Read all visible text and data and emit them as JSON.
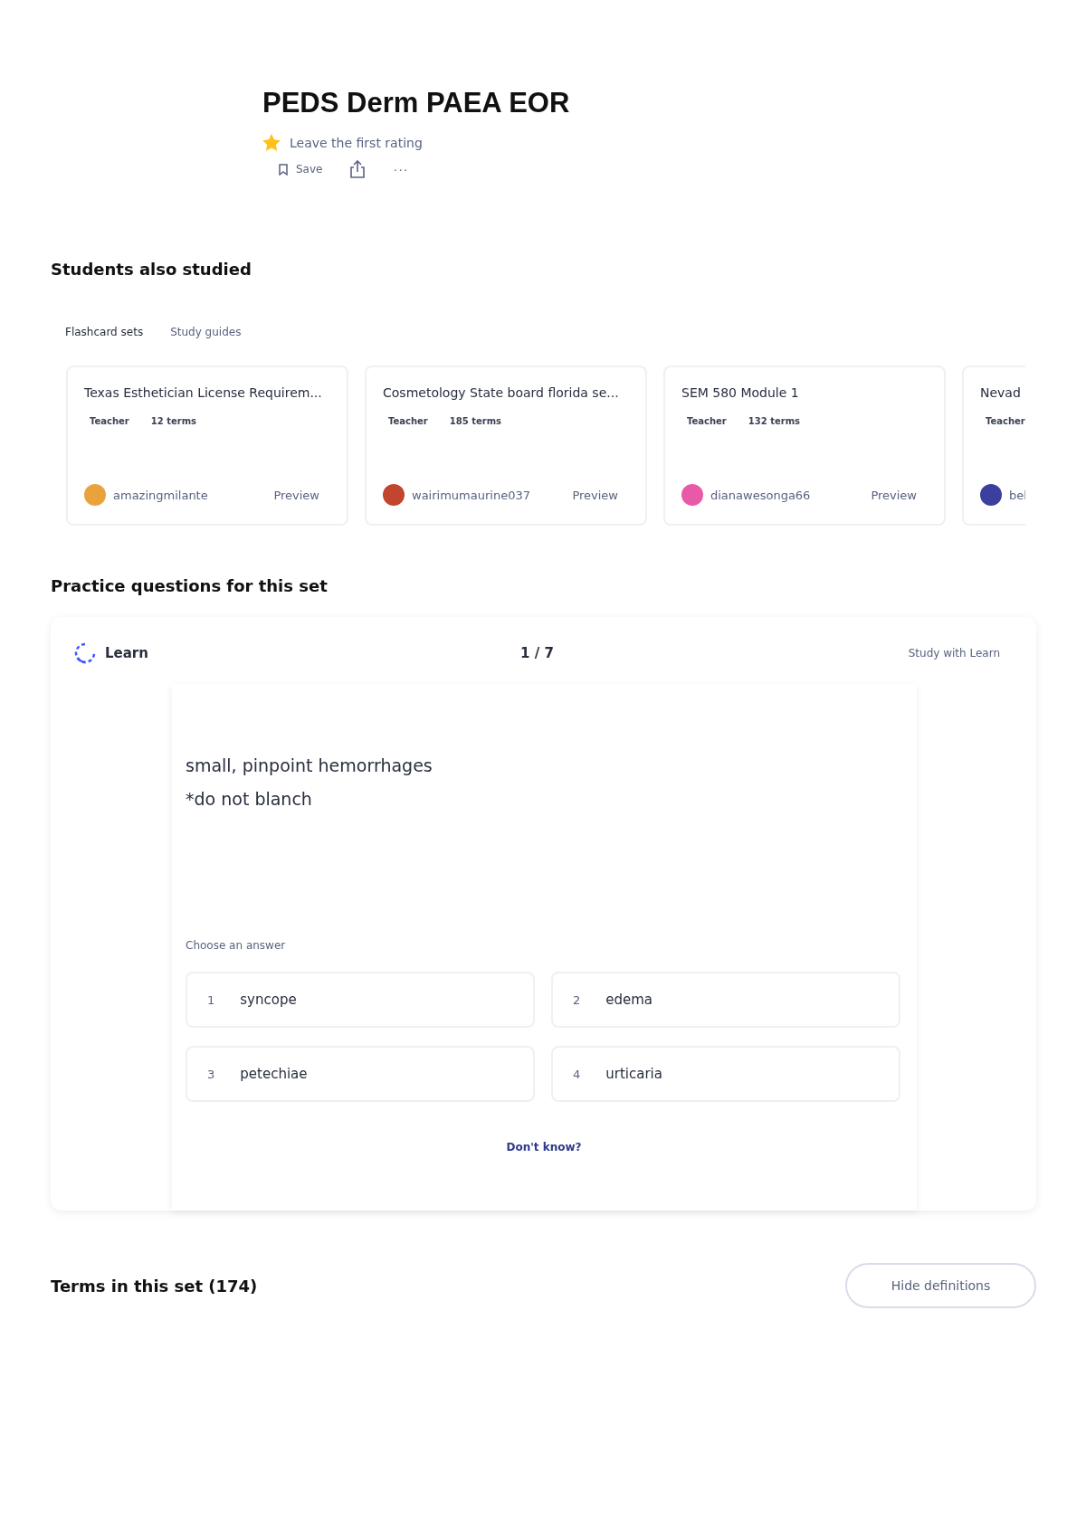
{
  "set": {
    "title": "PEDS Derm PAEA EOR",
    "rating": "Leave the first rating",
    "save": "Save",
    "more": "···"
  },
  "students_also_studied": {
    "heading": "Students also studied",
    "tabs": [
      {
        "label": "Flashcard sets",
        "selected": true
      },
      {
        "label": "Study guides",
        "selected": false
      }
    ],
    "cards": [
      {
        "title": "Texas Esthetician License Requirem...",
        "role": "Teacher",
        "terms": "12 terms",
        "author": "amazingmilante",
        "preview": "Preview",
        "color": "#e8a33c"
      },
      {
        "title": "Cosmetology State board florida se...",
        "role": "Teacher",
        "terms": "185 terms",
        "author": "wairimumaurine037",
        "preview": "Preview",
        "color": "#c2452d"
      },
      {
        "title": "SEM 580 Module 1",
        "role": "Teacher",
        "terms": "132 terms",
        "author": "dianawesonga66",
        "preview": "Preview",
        "color": "#e85aa8"
      },
      {
        "title": "Nevad",
        "role": "Teacher",
        "author": "bel",
        "color": "#3b3f9e"
      }
    ]
  },
  "practice": {
    "heading": "Practice questions for this set",
    "mode": "Learn",
    "progress": "1 / 7",
    "study_link": "Study with Learn",
    "question": [
      "small, pinpoint hemorrhages",
      "*do not blanch"
    ],
    "prompt": "Choose an answer",
    "answers": [
      {
        "number": "1",
        "text": "syncope"
      },
      {
        "number": "2",
        "text": "edema"
      },
      {
        "number": "3",
        "text": "petechiae"
      },
      {
        "number": "4",
        "text": "urticaria"
      }
    ],
    "dont_know": "Don't know?"
  },
  "terms": {
    "heading": "Terms in this set (174)",
    "button": "Hide definitions"
  }
}
